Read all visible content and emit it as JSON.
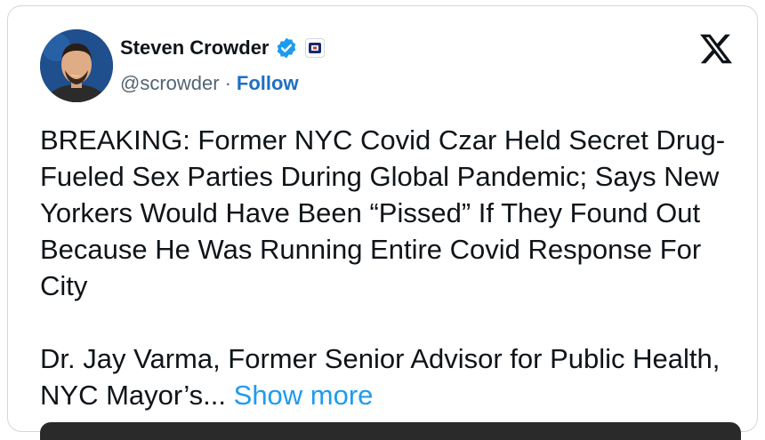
{
  "author": {
    "name": "Steven Crowder",
    "handle": "@scrowder",
    "separator": "·",
    "follow_label": "Follow",
    "verified_color": "#1d9bf0"
  },
  "tweet": {
    "paragraph1": "BREAKING: Former NYC Covid Czar Held Secret Drug-Fueled Sex Parties During Global Pandemic; Says New Yorkers Would Have Been “Pissed” If They Found Out Because He Was Running Entire Covid Response For City",
    "paragraph2": "Dr. Jay Varma, Former Senior Advisor for Public Health, NYC Mayor’s...",
    "show_more": "Show more"
  },
  "icons": {
    "logo": "x-logo-icon",
    "verified": "verified-badge-icon",
    "affiliate": "affiliate-badge-icon"
  }
}
